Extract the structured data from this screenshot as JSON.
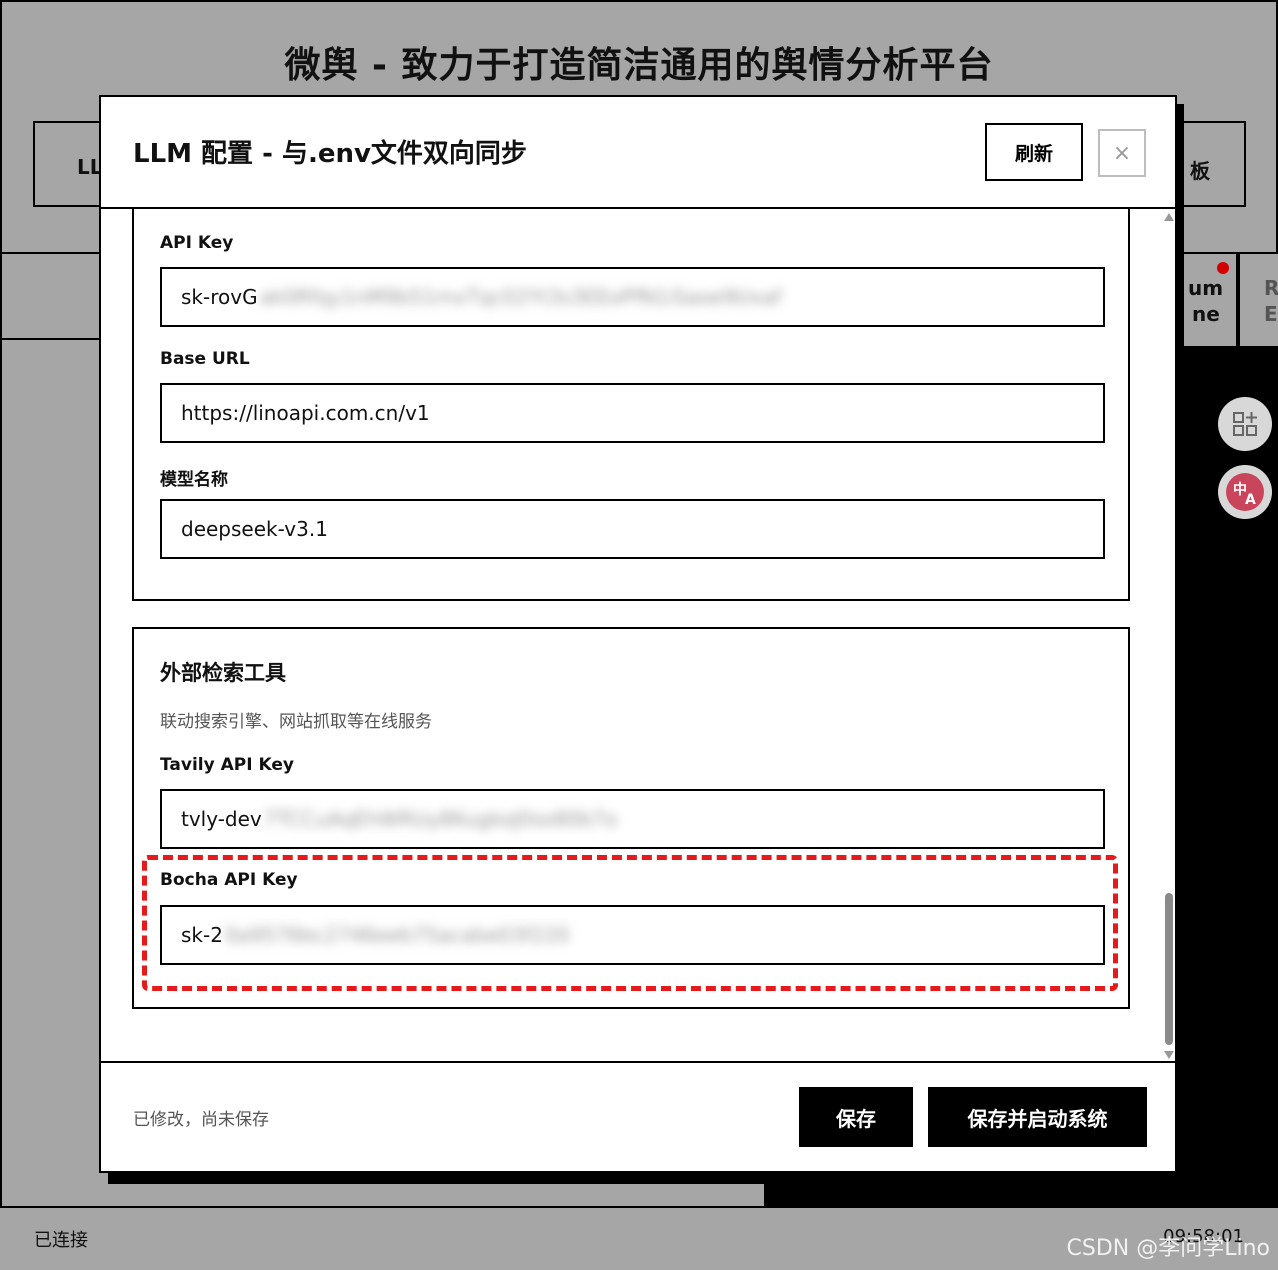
{
  "app": {
    "title": "微舆 - 致力于打造简洁通用的舆情分析平台"
  },
  "background": {
    "left_card_label": "LL",
    "right_card_label": "板",
    "right_tab_line1": "um",
    "right_tab_line2": "ne",
    "right_tab2_line1": "R",
    "right_tab2_line2": "E"
  },
  "status_bar": {
    "connection": "已连接",
    "time": "09:58:01"
  },
  "watermark": "CSDN @李问学Lino",
  "modal": {
    "title": "LLM 配置 - 与.env文件双向同步",
    "refresh_label": "刷新",
    "close_symbol": "×",
    "llm_section": {
      "fields": [
        {
          "label": "API Key",
          "value_visible": "sk-rovG",
          "value_blurred": "ak0Rfqy1nM9b51mxTqc02Yt3s3EEoPfN1iSaoe9Uxaf"
        },
        {
          "label": "Base URL",
          "value_visible": "https://linoapi.com.cn/v1",
          "value_blurred": ""
        },
        {
          "label": "模型名称",
          "value_visible": "deepseek-v3.1",
          "value_blurred": ""
        }
      ]
    },
    "search_section": {
      "title": "外部检索工具",
      "subtitle": "联动搜索引擎、网站抓取等在线服务",
      "fields": [
        {
          "label": "Tavily API Key",
          "value_visible": "tvly-dev",
          "value_blurred": "7TCCuAqEhWRUy8KugkoJ0so80b7o"
        },
        {
          "label": "Bocha API Key",
          "value_visible": "sk-2",
          "value_blurred": "0a9576bc2746eeb75acabe03f220"
        }
      ]
    },
    "footer": {
      "status": "已修改，尚未保存",
      "save_label": "保存",
      "save_start_label": "保存并启动系统"
    }
  },
  "colors": {
    "background": "#a6a6a6",
    "highlight": "#e61a1a",
    "primary": "#000000"
  }
}
